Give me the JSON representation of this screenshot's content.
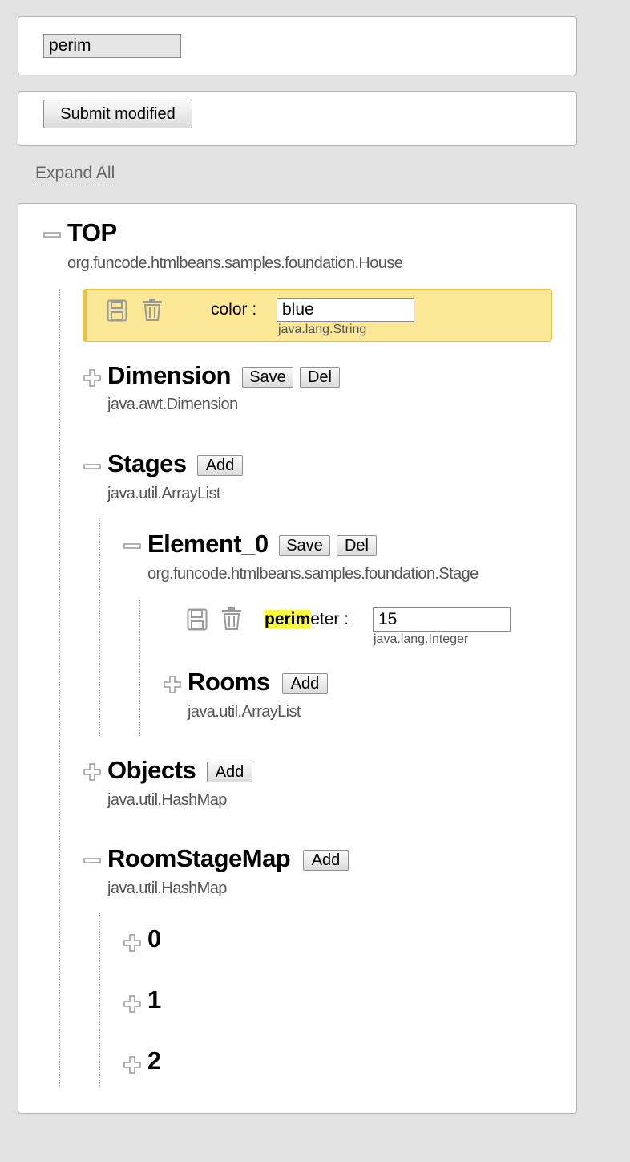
{
  "search": {
    "value": "perim"
  },
  "submit": {
    "label": "Submit modified"
  },
  "expand_all": {
    "label": "Expand All"
  },
  "tree": {
    "top": {
      "title": "TOP",
      "type": "org.funcode.htmlbeans.samples.foundation.House"
    },
    "color_prop": {
      "label": "color :",
      "value": "blue",
      "type": "java.lang.String"
    },
    "dimension": {
      "title": "Dimension",
      "type": "java.awt.Dimension",
      "save_label": "Save",
      "del_label": "Del"
    },
    "stages": {
      "title": "Stages",
      "type": "java.util.ArrayList",
      "add_label": "Add"
    },
    "element0": {
      "title": "Element_0",
      "type": "org.funcode.htmlbeans.samples.foundation.Stage",
      "save_label": "Save",
      "del_label": "Del"
    },
    "perimeter_prop": {
      "label_match": "perim",
      "label_rest": "eter :",
      "value": "15",
      "type": "java.lang.Integer"
    },
    "rooms": {
      "title": "Rooms",
      "type": "java.util.ArrayList",
      "add_label": "Add"
    },
    "objects": {
      "title": "Objects",
      "type": "java.util.HashMap",
      "add_label": "Add"
    },
    "roomstagemap": {
      "title": "RoomStageMap",
      "type": "java.util.HashMap",
      "add_label": "Add"
    },
    "map_keys": [
      "0",
      "1",
      "2"
    ]
  },
  "colors": {
    "highlight_row": "#fbe796",
    "match_highlight": "#fbfb3c",
    "page_bg": "#e3e3e3"
  },
  "icons": {
    "collapse": "minus-icon",
    "expand": "plus-icon",
    "save": "floppy-disk-icon",
    "delete": "trash-icon"
  }
}
